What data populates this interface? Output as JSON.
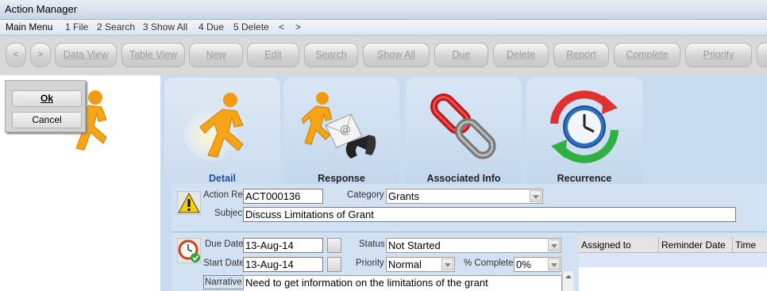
{
  "window": {
    "title": "Action Manager"
  },
  "menu": {
    "main": "Main Menu",
    "items": [
      "1 File",
      "2 Search",
      "3 Show All",
      "4 Due",
      "5 Delete"
    ],
    "back": "<",
    "forward": ">"
  },
  "toolbar": {
    "back": "<",
    "forward": ">",
    "buttons": [
      "Data View",
      "Table View",
      "New",
      "Edit",
      "Search",
      "Show All",
      "Due",
      "Delete",
      "Report",
      "Complete",
      "Priority"
    ]
  },
  "dialog": {
    "ok": "Ok",
    "cancel": "Cancel"
  },
  "tabs": [
    "Detail",
    "Response",
    "Associated Info",
    "Recurrence"
  ],
  "form": {
    "action_ref_label": "Action Ref",
    "action_ref": "ACT000136",
    "category_label": "Category",
    "category": "Grants",
    "subject_label": "Subject",
    "subject": "Discuss Limitations of Grant",
    "due_date_label": "Due Date",
    "due_date": "13-Aug-14",
    "start_date_label": "Start Date",
    "start_date": "13-Aug-14",
    "status_label": "Status",
    "status": "Not Started",
    "priority_label": "Priority",
    "priority": "Normal",
    "complete_label": "% Complete",
    "complete": "0%",
    "narrative_label": "Narrative",
    "narrative": "Need to get information on the limitations of the grant"
  },
  "grid": {
    "columns": [
      "Assigned to",
      "Reminder Date",
      "Time"
    ]
  },
  "colors": {
    "panel": "#c8dbef",
    "toolbar": "#d9d9d9",
    "active_tab_label": "#1f4fa0"
  },
  "icons": [
    "running-man-icon",
    "warning-icon",
    "clock-check-icon",
    "calendar-icon",
    "email-phone-icon",
    "chain-link-icon",
    "recurrence-clock-icon"
  ]
}
